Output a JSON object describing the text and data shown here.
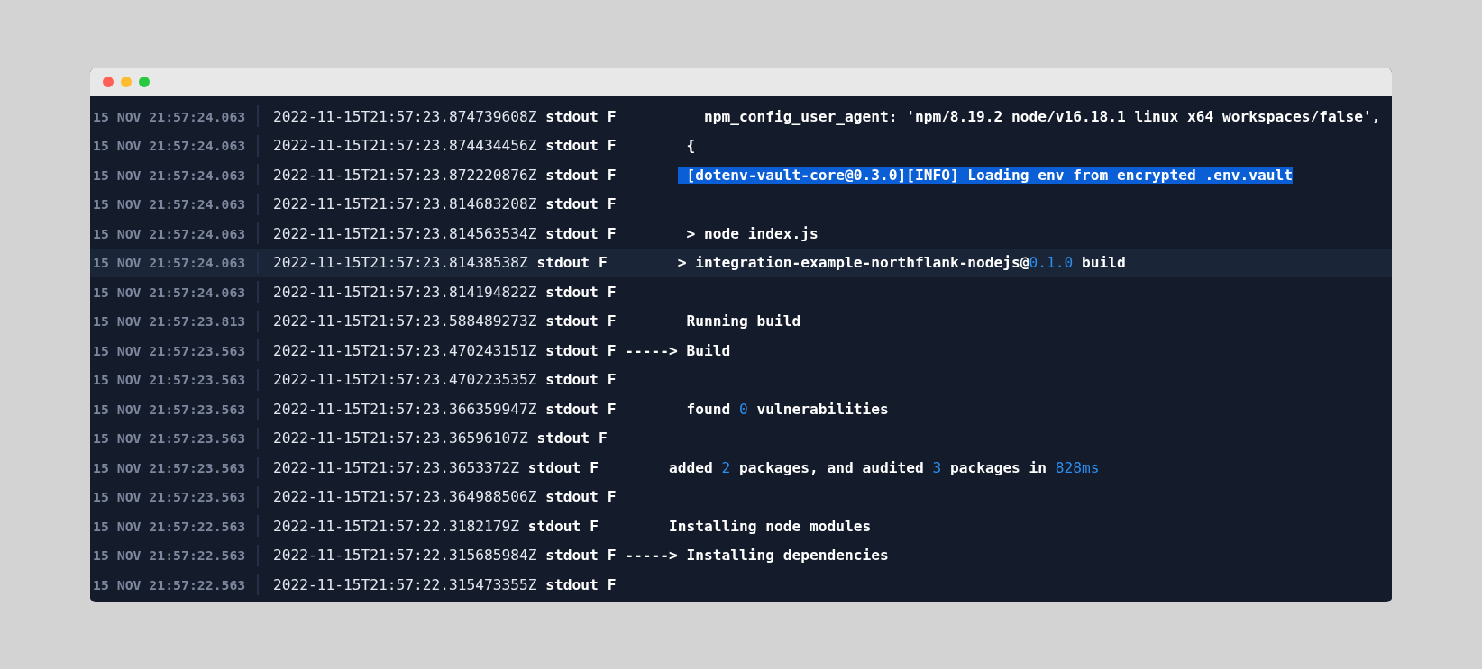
{
  "log_rows": [
    {
      "date": "15 NOV 21:57:24.063",
      "timestamp": "2022-11-15T21:57:23.874739608Z",
      "stream": "stdout",
      "flag": "F",
      "highlighted": false,
      "message": [
        {
          "kind": "plain",
          "text": "         npm_config_user_agent: 'npm/8.19.2 node/v16.18.1 linux x64 workspaces/false',"
        }
      ]
    },
    {
      "date": "15 NOV 21:57:24.063",
      "timestamp": "2022-11-15T21:57:23.874434456Z",
      "stream": "stdout",
      "flag": "F",
      "highlighted": false,
      "message": [
        {
          "kind": "plain",
          "text": "       {"
        }
      ]
    },
    {
      "date": "15 NOV 21:57:24.063",
      "timestamp": "2022-11-15T21:57:23.872220876Z",
      "stream": "stdout",
      "flag": "F",
      "highlighted": false,
      "message": [
        {
          "kind": "selected",
          "text": "       [dotenv-vault-core@0.3.0][INFO] Loading env from encrypted .env.vault"
        }
      ]
    },
    {
      "date": "15 NOV 21:57:24.063",
      "timestamp": "2022-11-15T21:57:23.814683208Z",
      "stream": "stdout",
      "flag": "F",
      "highlighted": false
    },
    {
      "date": "15 NOV 21:57:24.063",
      "timestamp": "2022-11-15T21:57:23.814563534Z",
      "stream": "stdout",
      "flag": "F",
      "highlighted": false,
      "message": [
        {
          "kind": "plain",
          "text": "       > node index.js"
        }
      ]
    },
    {
      "date": "15 NOV 21:57:24.063",
      "timestamp": "2022-11-15T21:57:23.81438538Z",
      "stream": "stdout",
      "flag": "F",
      "highlighted": true,
      "message": [
        {
          "kind": "plain",
          "text": "       > integration-example-northflank-nodejs@"
        },
        {
          "kind": "number",
          "text": "0.1.0"
        },
        {
          "kind": "plain",
          "text": " build"
        }
      ]
    },
    {
      "date": "15 NOV 21:57:24.063",
      "timestamp": "2022-11-15T21:57:23.814194822Z",
      "stream": "stdout",
      "flag": "F",
      "highlighted": false
    },
    {
      "date": "15 NOV 21:57:23.813",
      "timestamp": "2022-11-15T21:57:23.588489273Z",
      "stream": "stdout",
      "flag": "F",
      "highlighted": false,
      "message": [
        {
          "kind": "plain",
          "text": "       Running build"
        }
      ]
    },
    {
      "date": "15 NOV 21:57:23.563",
      "timestamp": "2022-11-15T21:57:23.470243151Z",
      "stream": "stdout",
      "flag": "F",
      "highlighted": false,
      "message": [
        {
          "kind": "plain",
          "text": "-----> Build"
        }
      ]
    },
    {
      "date": "15 NOV 21:57:23.563",
      "timestamp": "2022-11-15T21:57:23.470223535Z",
      "stream": "stdout",
      "flag": "F",
      "highlighted": false
    },
    {
      "date": "15 NOV 21:57:23.563",
      "timestamp": "2022-11-15T21:57:23.366359947Z",
      "stream": "stdout",
      "flag": "F",
      "highlighted": false,
      "message": [
        {
          "kind": "plain",
          "text": "       found "
        },
        {
          "kind": "number",
          "text": "0"
        },
        {
          "kind": "plain",
          "text": " vulnerabilities"
        }
      ]
    },
    {
      "date": "15 NOV 21:57:23.563",
      "timestamp": "2022-11-15T21:57:23.36596107Z",
      "stream": "stdout",
      "flag": "F",
      "highlighted": false
    },
    {
      "date": "15 NOV 21:57:23.563",
      "timestamp": "2022-11-15T21:57:23.3653372Z",
      "stream": "stdout",
      "flag": "F",
      "highlighted": false,
      "message": [
        {
          "kind": "plain",
          "text": "       added "
        },
        {
          "kind": "number",
          "text": "2"
        },
        {
          "kind": "plain",
          "text": " packages, and audited "
        },
        {
          "kind": "number",
          "text": "3"
        },
        {
          "kind": "plain",
          "text": " packages in "
        },
        {
          "kind": "number",
          "text": "828ms"
        }
      ]
    },
    {
      "date": "15 NOV 21:57:23.563",
      "timestamp": "2022-11-15T21:57:23.364988506Z",
      "stream": "stdout",
      "flag": "F",
      "highlighted": false
    },
    {
      "date": "15 NOV 21:57:22.563",
      "timestamp": "2022-11-15T21:57:22.3182179Z",
      "stream": "stdout",
      "flag": "F",
      "highlighted": false,
      "message": [
        {
          "kind": "plain",
          "text": "       Installing node modules"
        }
      ]
    },
    {
      "date": "15 NOV 21:57:22.563",
      "timestamp": "2022-11-15T21:57:22.315685984Z",
      "stream": "stdout",
      "flag": "F",
      "highlighted": false,
      "message": [
        {
          "kind": "plain",
          "text": "-----> Installing dependencies"
        }
      ]
    },
    {
      "date": "15 NOV 21:57:22.563",
      "timestamp": "2022-11-15T21:57:22.315473355Z",
      "stream": "stdout",
      "flag": "F",
      "highlighted": false
    }
  ]
}
